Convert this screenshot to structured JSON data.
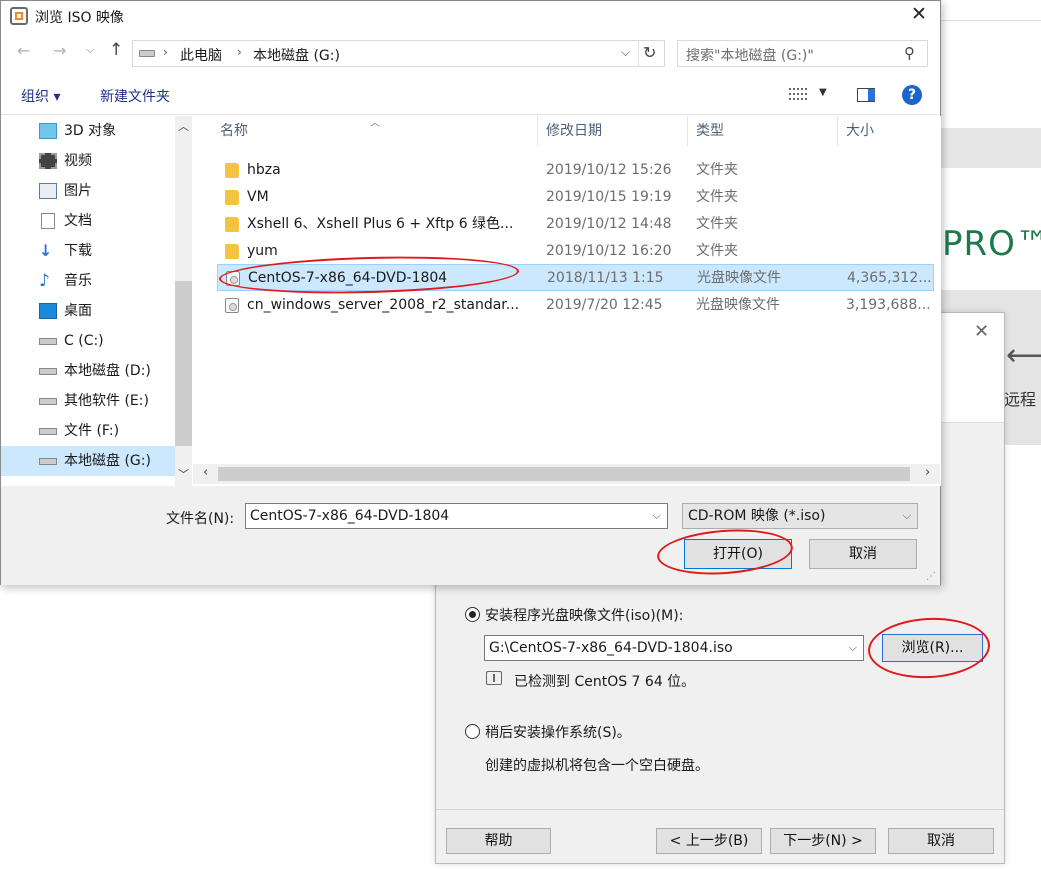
{
  "background": {
    "brand_text": "PRO™",
    "remote_text": "远程"
  },
  "wizard": {
    "install_iso_label": "安装程序光盘映像文件(iso)(M):",
    "iso_path": "G:\\CentOS-7-x86_64-DVD-1804.iso",
    "browse_label": "浏览(R)...",
    "detected_text": "已检测到 CentOS 7 64 位。",
    "later_label": "稍后安装操作系统(S)。",
    "later_desc": "创建的虚拟机将包含一个空白硬盘。",
    "help_label": "帮助",
    "back_label": "< 上一步(B)",
    "next_label": "下一步(N) >",
    "cancel_label": "取消"
  },
  "dialog": {
    "title": "浏览 ISO 映像",
    "breadcrumb": [
      "此电脑",
      "本地磁盘 (G:)"
    ],
    "search_placeholder": "搜索\"本地磁盘 (G:)\"",
    "toolbar": {
      "organize": "组织 ▾",
      "new_folder": "新建文件夹"
    },
    "nav_items": [
      {
        "label": "3D 对象",
        "icon": "3d-objects-icon"
      },
      {
        "label": "视频",
        "icon": "video-icon"
      },
      {
        "label": "图片",
        "icon": "pictures-icon"
      },
      {
        "label": "文档",
        "icon": "documents-icon"
      },
      {
        "label": "下载",
        "icon": "download-icon"
      },
      {
        "label": "音乐",
        "icon": "music-icon"
      },
      {
        "label": "桌面",
        "icon": "desktop-icon"
      },
      {
        "label": "C (C:)",
        "icon": "drive-c-icon"
      },
      {
        "label": "本地磁盘 (D:)",
        "icon": "drive-icon"
      },
      {
        "label": "其他软件 (E:)",
        "icon": "drive-icon"
      },
      {
        "label": "文件 (F:)",
        "icon": "drive-icon"
      },
      {
        "label": "本地磁盘 (G:)",
        "icon": "drive-icon",
        "selected": true
      }
    ],
    "columns": {
      "name": "名称",
      "modified": "修改日期",
      "type": "类型",
      "size": "大小"
    },
    "files": [
      {
        "name": "hbza",
        "modified": "2019/10/12 15:26",
        "type": "文件夹",
        "size": "",
        "icon": "folder-icon"
      },
      {
        "name": "VM",
        "modified": "2019/10/15 19:19",
        "type": "文件夹",
        "size": "",
        "icon": "folder-icon"
      },
      {
        "name": "Xshell 6、Xshell Plus 6 + Xftp 6 绿色...",
        "modified": "2019/10/12 14:48",
        "type": "文件夹",
        "size": "",
        "icon": "folder-icon"
      },
      {
        "name": "yum",
        "modified": "2019/10/12 16:20",
        "type": "文件夹",
        "size": "",
        "icon": "folder-icon"
      },
      {
        "name": "CentOS-7-x86_64-DVD-1804",
        "modified": "2018/11/13 1:15",
        "type": "光盘映像文件",
        "size": "4,365,312...",
        "icon": "disc-image-icon",
        "selected": true
      },
      {
        "name": "cn_windows_server_2008_r2_standar...",
        "modified": "2019/7/20 12:45",
        "type": "光盘映像文件",
        "size": "3,193,688...",
        "icon": "disc-image-icon"
      }
    ],
    "filename_label": "文件名(N):",
    "filename_value": "CentOS-7-x86_64-DVD-1804",
    "filter_value": "CD-ROM 映像 (*.iso)",
    "open_label": "打开(O)",
    "cancel_label": "取消"
  },
  "colors": {
    "selection": "#cce8ff",
    "annotation": "#e01a1a",
    "brand_green": "#1e7a4a",
    "help_blue": "#1b66c9"
  }
}
